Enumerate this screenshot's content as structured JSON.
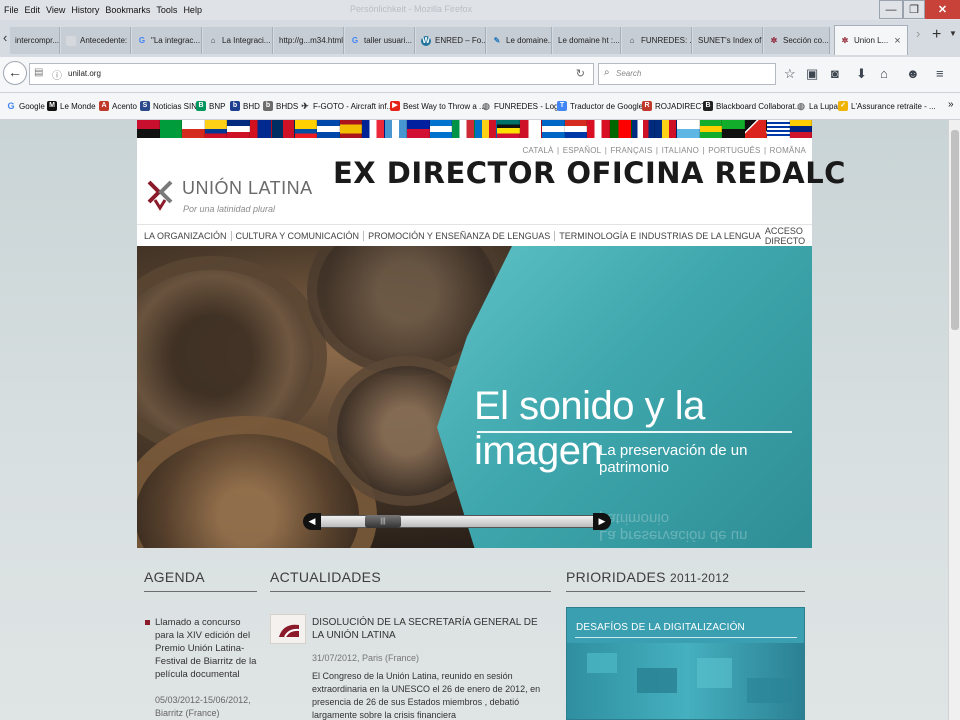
{
  "menubar": {
    "items": [
      "File",
      "Edit",
      "View",
      "History",
      "Bookmarks",
      "Tools",
      "Help"
    ],
    "background_title": "Persönlichkeit - Mozilla Firefox"
  },
  "tabs": [
    {
      "label": "intercompr...",
      "icon": "page-icon"
    },
    {
      "label": "Antecedente: Pro...",
      "icon": "page-icon"
    },
    {
      "label": "\"La integrac...",
      "icon": "google-icon"
    },
    {
      "label": "La Integraci...",
      "icon": "institution-icon"
    },
    {
      "label": "http://g...m34.html",
      "icon": "page-icon"
    },
    {
      "label": "taller usuari...",
      "icon": "google-icon"
    },
    {
      "label": "ENRED – Fo...",
      "icon": "wordpress-icon"
    },
    {
      "label": "Le domaine...",
      "icon": "feather-icon"
    },
    {
      "label": "Le domaine ht :...",
      "icon": "page-icon"
    },
    {
      "label": "FUNREDES: ...",
      "icon": "institution-icon"
    },
    {
      "label": "SUNET's Index of...",
      "icon": "page-icon"
    },
    {
      "label": "Sección co...",
      "icon": "ul-logo-icon"
    },
    {
      "label": "Union L...",
      "icon": "ul-logo-icon",
      "active": true
    }
  ],
  "navbar": {
    "url": "unilat.org",
    "search_placeholder": "Search"
  },
  "bookmarks": [
    {
      "label": "Google",
      "icon": "google-icon",
      "color": "#4285f4"
    },
    {
      "label": "Le Monde",
      "icon": "lemonde-icon",
      "color": "#111111"
    },
    {
      "label": "Acento",
      "icon": "acento-icon",
      "color": "#c0392b"
    },
    {
      "label": "Noticias SIN",
      "icon": "sin-icon",
      "color": "#2b4a8b"
    },
    {
      "label": "BNP",
      "icon": "bnp-icon",
      "color": "#00965e"
    },
    {
      "label": "BHD",
      "icon": "bhd-icon",
      "color": "#1d3f8f"
    },
    {
      "label": "BHDS",
      "icon": "bhds-icon",
      "color": "#6d6d6d"
    },
    {
      "label": "F-GOTO - Aircraft inf...",
      "icon": "plane-icon",
      "color": "#333333"
    },
    {
      "label": "Best Way to Throw a ...",
      "icon": "youtube-icon",
      "color": "#e62117"
    },
    {
      "label": "FUNREDES - Login",
      "icon": "globe-icon",
      "color": "#777777"
    },
    {
      "label": "Traductor de Google",
      "icon": "translate-icon",
      "color": "#4285f4"
    },
    {
      "label": "ROJADIRECTA",
      "icon": "roja-icon",
      "color": "#c0392b"
    },
    {
      "label": "Blackboard Collaborat...",
      "icon": "blackboard-icon",
      "color": "#222222"
    },
    {
      "label": "La Lupa",
      "icon": "globe-icon",
      "color": "#777777"
    },
    {
      "label": "L'Assurance retraite - ...",
      "icon": "pension-icon",
      "color": "#f0b400"
    }
  ],
  "site": {
    "languages": [
      "CATALÀ",
      "ESPAÑOL",
      "FRANÇAIS",
      "ITALIANO",
      "PORTUGUÊS",
      "ROMÂNA"
    ],
    "brand": "UNIÓN LATINA",
    "tagline": "Por una latinidad plural",
    "overlay_title": "EX DIRECTOR OFICINA REDALC",
    "nav": [
      "LA ORGANIZACIÓN",
      "CULTURA Y COMUNICACIÓN",
      "PROMOCIÓN Y ENSEÑANZA DE LENGUAS",
      "TERMINOLOGÍA E INDUSTRIAS DE LA LENGUA"
    ],
    "nav_right": "ACCESO DIRECTO",
    "hero": {
      "title": "El sonido y la imagen",
      "subtitle": "La preservación de un patrimonio",
      "slider_left": "◀",
      "slider_right": "▶",
      "slider_grip": "|||"
    },
    "agenda": {
      "heading": "AGENDA",
      "item_text": "Llamado a concurso para la XIV edición del Premio Unión Latina-Festival de Biarritz de la película documental",
      "item_date": "05/03/2012-15/06/2012, Biarritz (France)"
    },
    "news": {
      "heading": "ACTUALIDADES",
      "title": "DISOLUCIÓN DE LA SECRETARÍA GENERAL DE LA UNIÓN LATINA",
      "date": "31/07/2012, Paris (France)",
      "body": "El Congreso de la Unión Latina, reunido en sesión extraordinaria en la UNESCO el 26 de enero de 2012, en presencia de 26 de sus Estados miembros , debatió largamente sobre la crisis financiera"
    },
    "priorities": {
      "heading": "PRIORIDADES",
      "years": "2011-2012",
      "box_title": "DESAFÍOS DE LA DIGITALIZACIÓN"
    }
  },
  "colors": {
    "accent_red": "#8b1a2b",
    "teal": "#3a9fb0",
    "close_red": "#c8423a"
  }
}
